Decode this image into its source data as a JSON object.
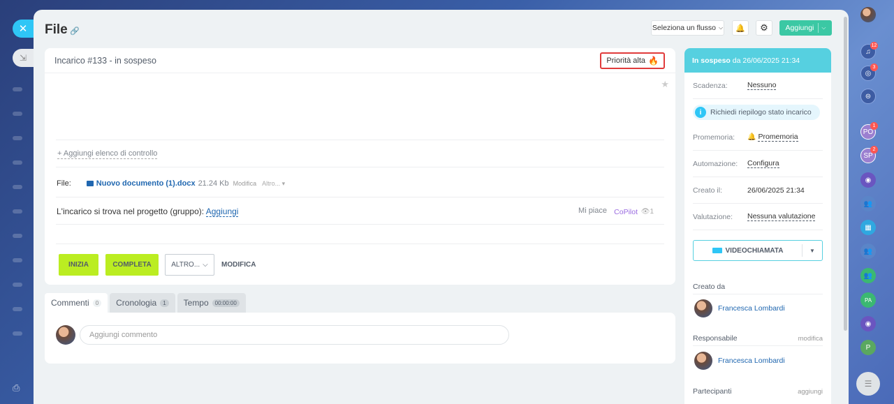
{
  "header": {
    "title": "File",
    "flow_select": "Seleziona un flusso",
    "add_label": "Aggiungi"
  },
  "task": {
    "title": "Incarico #133 - in sospeso",
    "priority": "Priorità alta",
    "add_checklist": "+ Aggiungi elenco di controllo",
    "file_label": "File:",
    "file_name": "Nuovo documento (1).docx",
    "file_size": "21.24 Kb",
    "file_edit": "Modifica",
    "file_more": "Altro... ▾",
    "project_text": "L'incarico si trova nel progetto (gruppo):",
    "project_link": "Aggiungi",
    "like": "Mi piace",
    "copilot": "CoPilot",
    "views": "1"
  },
  "actions": {
    "start": "INIZIA",
    "complete": "COMPLETA",
    "more": "ALTRO...",
    "edit": "MODIFICA"
  },
  "tabs": [
    {
      "label": "Commenti",
      "badge": "0"
    },
    {
      "label": "Cronologia",
      "badge": "1"
    },
    {
      "label": "Tempo",
      "badge": "00:00:00"
    }
  ],
  "comment": {
    "placeholder": "Aggiungi commento"
  },
  "sidebar": {
    "status_bold": "In sospeso",
    "status_rest": " da 26/06/2025 21:34",
    "deadline_label": "Scadenza:",
    "deadline_value": "Nessuno",
    "summary": "Richiedi riepilogo stato incarico",
    "reminder_label": "Promemoria:",
    "reminder_value": "Promemoria",
    "automation_label": "Automazione:",
    "automation_value": "Configura",
    "created_label": "Creato il:",
    "created_value": "26/06/2025 21:34",
    "rating_label": "Valutazione:",
    "rating_value": "Nessuna valutazione",
    "video_call": "VIDEOCHIAMATA",
    "created_by": "Creato da",
    "creator": "Francesca Lombardi",
    "responsible": "Responsabile",
    "responsible_action": "modifica",
    "responsible_person": "Francesca Lombardi",
    "participants": "Partecipanti",
    "participants_action": "aggiungi"
  },
  "right_rail": {
    "notifications_badge": "12",
    "activity_badge": "3",
    "user_po": "PO",
    "user_po_badge": "1",
    "user_sp": "SP",
    "user_sp_badge": "2",
    "user_pa": "PA",
    "user_p": "P"
  }
}
